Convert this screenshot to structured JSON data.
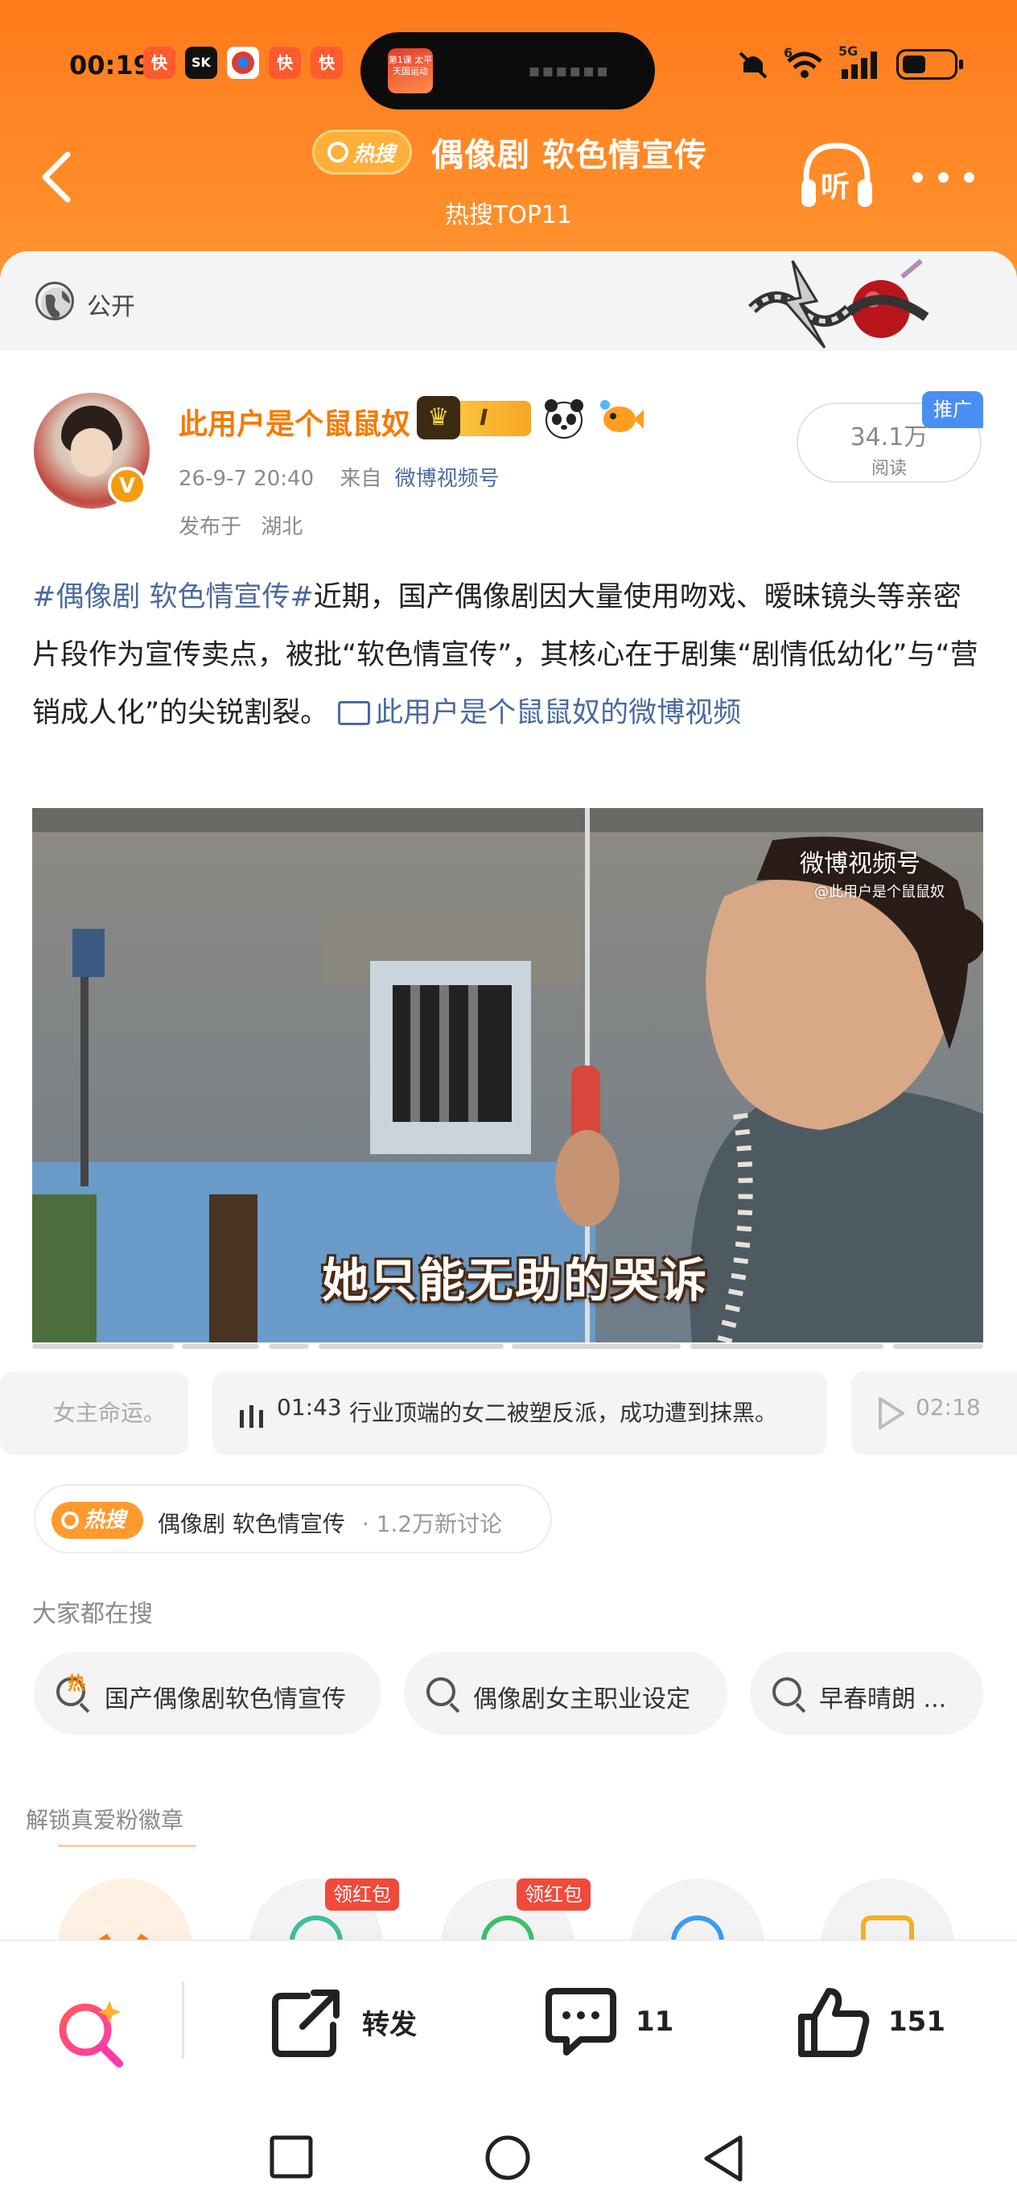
{
  "status_bar": {
    "time": "00:19",
    "apps": [
      "快",
      "SK",
      "",
      "快",
      "快"
    ],
    "island_thumb_text": "第1课 太平天国运动",
    "network_label": "5G",
    "signal_superscript": "6"
  },
  "header": {
    "hot_search_badge": "热搜",
    "title": "偶像剧  软色情宣传",
    "subtitle": "热搜TOP11",
    "listen_label": "听"
  },
  "visibility": {
    "label": "公开"
  },
  "post": {
    "username": "此用户是个鼠鼠奴",
    "vip_level": "I",
    "date": "26-9-7  20:40",
    "source_prefix": "来自",
    "source": "微博视频号",
    "location_prefix": "发布于",
    "location": "湖北",
    "reads_count": "34.1万",
    "reads_label": "阅读",
    "promo_tag": "推广",
    "topic": "#偶像剧  软色情宣传#",
    "body": "近期，国产偶像剧因大量使用吻戏、暧昧镜头等亲密片段作为宣传卖点，被批“软色情宣传”，其核心在于剧集“剧情低幼化”与“营销成人化”的尖锐割裂。",
    "video_link": "此用户是个鼠鼠奴的微博视频"
  },
  "video": {
    "watermark": "微博视频号",
    "watermark_sub": "@此用户是个鼠鼠奴",
    "subtitle": "她只能无助的哭诉"
  },
  "chapters": [
    {
      "time": "",
      "text": "女主命运。"
    },
    {
      "time": "01:43",
      "text": "行业顶端的女二被塑反派，成功遭到抹黑。"
    },
    {
      "time": "02:18",
      "text": ""
    }
  ],
  "hot_topic": {
    "badge": "热搜",
    "name": "偶像剧  软色情宣传",
    "count": "· 1.2万新讨论"
  },
  "everyone_searching": {
    "label": "大家都在搜",
    "items": [
      {
        "text": "国产偶像剧软色情宣传",
        "hot": "热"
      },
      {
        "text": "偶像剧女主职业设定",
        "hot": ""
      },
      {
        "text": "早春晴朗 ...",
        "hot": ""
      }
    ]
  },
  "fan_badges": {
    "label": "解锁真爱粉徽章",
    "red_packet_label": "领红包"
  },
  "actions": {
    "repost_label": "转发",
    "comment_count": "11",
    "like_count": "151"
  },
  "colors": {
    "header_orange": "#ff7a1c",
    "link_blue": "#4a6aa0",
    "username_orange": "#f57a00",
    "promo_blue": "#4b8ef2"
  }
}
